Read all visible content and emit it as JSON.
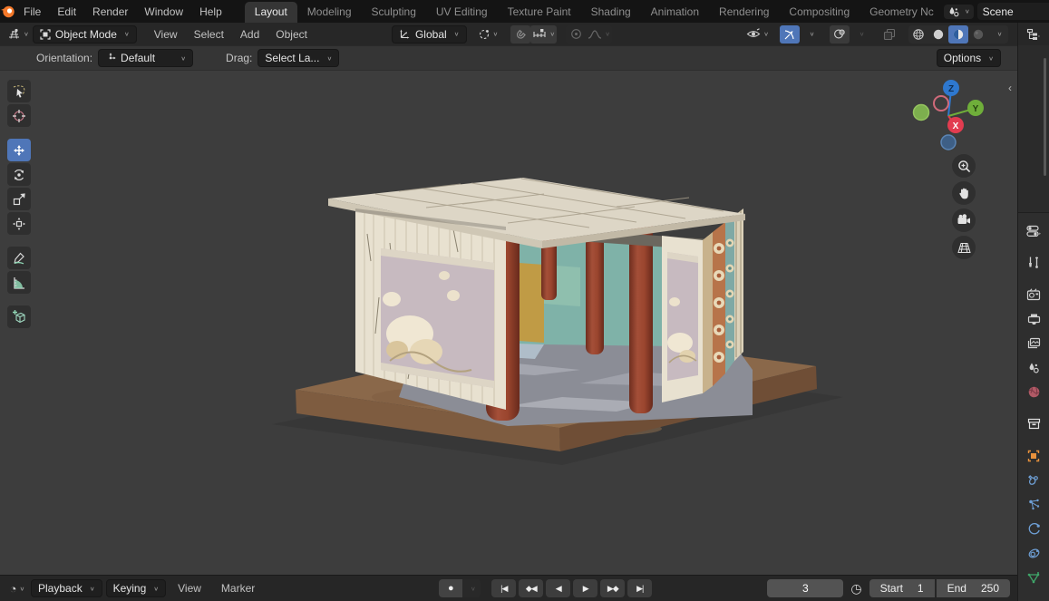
{
  "topbar": {
    "menus": [
      "File",
      "Edit",
      "Render",
      "Window",
      "Help"
    ],
    "tabs": [
      "Layout",
      "Modeling",
      "Sculpting",
      "UV Editing",
      "Texture Paint",
      "Shading",
      "Animation",
      "Rendering",
      "Compositing",
      "Geometry Nc"
    ],
    "active_tab": "Layout",
    "scene_selector": {
      "value": "Scene"
    }
  },
  "viewport_header": {
    "mode": "Object Mode",
    "menus": [
      "View",
      "Select",
      "Add",
      "Object"
    ],
    "transform_orientation": "Global"
  },
  "tool_settings": {
    "orientation_label": "Orientation:",
    "orientation_value": "Default",
    "drag_label": "Drag:",
    "drag_value": "Select La...",
    "options_label": "Options"
  },
  "nav_gizmo": {
    "axis_x": "X",
    "axis_y": "Y",
    "axis_z": "Z"
  },
  "timeline": {
    "menus": [
      "Playback",
      "Keying",
      "View",
      "Marker"
    ],
    "transport": [
      "|◀",
      "◆◀",
      "◀",
      "▶",
      "▶◆",
      "▶|"
    ],
    "current_frame": "3",
    "start_label": "Start",
    "start_value": "1",
    "end_label": "End",
    "end_value": "250"
  },
  "icons": {
    "chevron_down": "∨",
    "close": "×",
    "record_dot": "●",
    "stopwatch": "◷",
    "clock": "◔",
    "collapse_left": "‹"
  },
  "colors": {
    "accent_blue": "#4f76b8",
    "axis_x_red": "#e23c50",
    "axis_y_green": "#6fae3a",
    "axis_z_blue": "#2e78cf",
    "object_orange": "#e8913c",
    "data_green": "#3fa66a",
    "world_pink": "#c46a6a",
    "column_red": "#9a4530",
    "platform_brown": "#8a684a",
    "roof_cream": "#ddd6c6",
    "fresco_mauve": "#c7bac0",
    "interior_teal": "#7fb2a8"
  }
}
